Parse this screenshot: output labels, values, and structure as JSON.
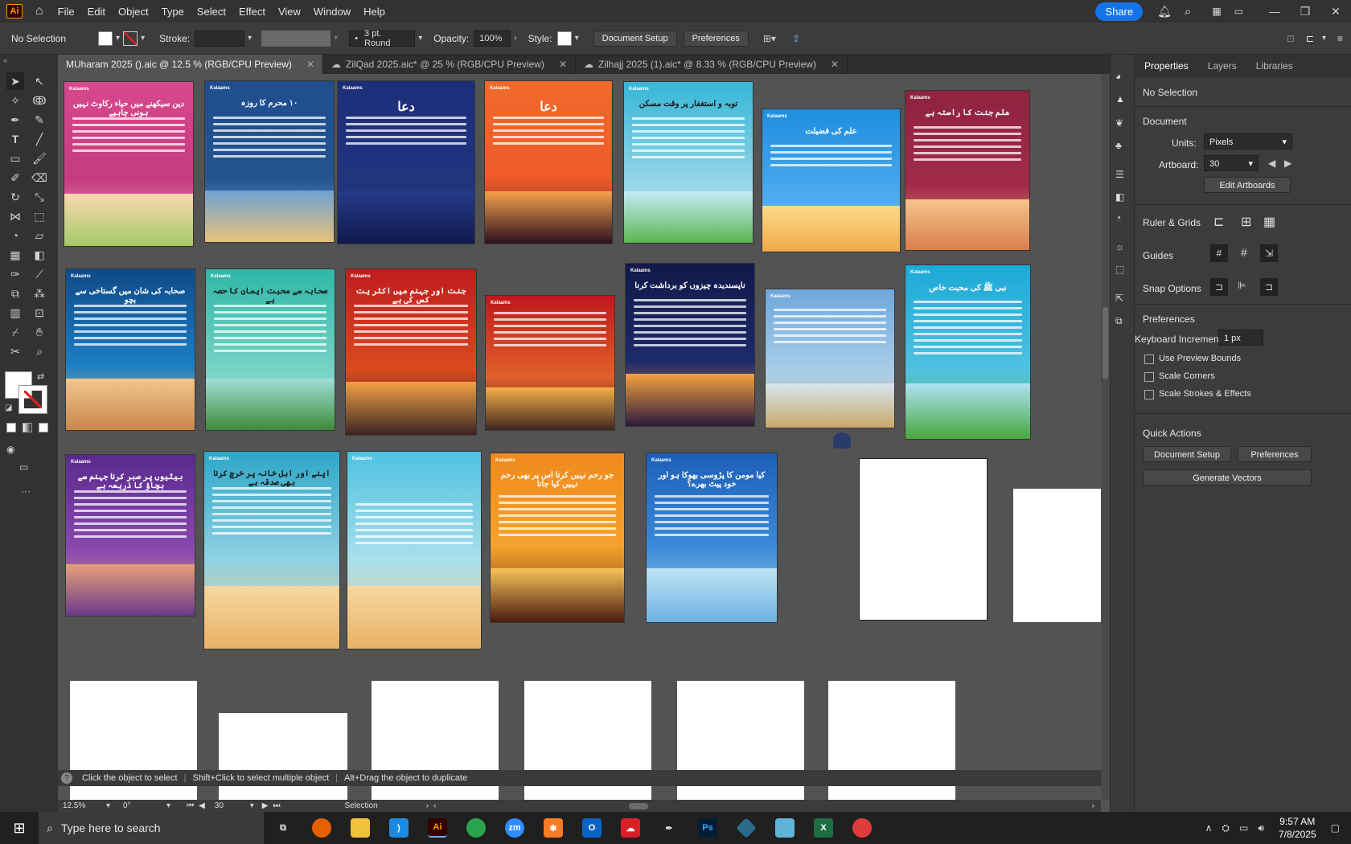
{
  "menubar": {
    "logo": "Ai",
    "items": [
      "File",
      "Edit",
      "Object",
      "Type",
      "Select",
      "Effect",
      "View",
      "Window",
      "Help"
    ],
    "share": "Share"
  },
  "control": {
    "selection": "No Selection",
    "stroke_label": "Stroke:",
    "brush": "3 pt. Round",
    "opacity_label": "Opacity:",
    "opacity": "100%",
    "style_label": "Style:",
    "doc_setup": "Document Setup",
    "preferences": "Preferences"
  },
  "tabs": [
    {
      "label": "MUharam 2025 ().aic @ 12.5 % (RGB/CPU Preview)"
    },
    {
      "label": "ZilQad 2025.aic* @ 25 % (RGB/CPU Preview)"
    },
    {
      "label": "Zilhajj 2025 (1).aic* @ 8.33 % (RGB/CPU Preview)"
    }
  ],
  "props": {
    "tabs": [
      "Properties",
      "Layers",
      "Libraries"
    ],
    "no_selection": "No Selection",
    "document": "Document",
    "units_label": "Units:",
    "units": "Pixels",
    "artboard_label": "Artboard:",
    "artboard": "30",
    "edit_artboards": "Edit Artboards",
    "rulers": "Ruler & Grids",
    "guides": "Guides",
    "snap": "Snap Options",
    "preferences": "Preferences",
    "kb_label": "Keyboard Increment:",
    "kb": "1 px",
    "chk1": "Use Preview Bounds",
    "chk2": "Scale Corners",
    "chk3": "Scale Strokes & Effects",
    "quick": "Quick Actions",
    "qa_doc": "Document Setup",
    "qa_pref": "Preferences",
    "qa_vec": "Generate Vectors"
  },
  "boards": [
    {
      "title": "دین سیکھنے میں حیاء رکاوٹ نہیں ہونی چاہیے",
      "color": "#d9488e"
    },
    {
      "title": "۱۰ محرم کا روزہ",
      "color": "#1f4e8f"
    },
    {
      "title": "دعا",
      "color": "#1c2e7a"
    },
    {
      "title": "دعا",
      "color": "#f06a2a"
    },
    {
      "title": "توبہ و استغفار پر وقت مسکن",
      "color": "#36b6d8"
    },
    {
      "title": "علم کی فضیلت",
      "color": "#1e8ee0"
    },
    {
      "title": "علم جنت کا راستہ ہے",
      "color": "#8e2340"
    },
    {
      "title": "صحابہ کی شان میں گستاخی سے بچو",
      "color": "#0f4a8a"
    },
    {
      "title": "صحابہ سے محبت ایمان کا حصہ ہے",
      "color": "#2fb7a8"
    },
    {
      "title": "جنت اور جہنم میں اکثر یت کس کی ہے",
      "color": "#c01d1d"
    },
    {
      "title": "",
      "color": "#c0161d"
    },
    {
      "title": "ناپسندیدہ چیزوں کو برداشت کرنا",
      "color": "#121a4a"
    },
    {
      "title": "",
      "color": "#6ea8dc"
    },
    {
      "title": "نبی ﷺ کی محبت خاص",
      "color": "#1da9d8"
    },
    {
      "title": "بیٹیوں پر صبر کرنا جہنم سے بچاؤ کا ذریعہ ہے",
      "color": "#5a2a8e"
    },
    {
      "title": "اپنے اور اہل خانہ پر خرچ کرنا بھی صدقہ ہے",
      "color": "#2ea7c8"
    },
    {
      "title": "",
      "color": "#4fc1e0"
    },
    {
      "title": "جو رحم نہیں کرتا اس پر بھی رحم نہیں کیا جاتا",
      "color": "#f08a1c"
    },
    {
      "title": "کیا مومن کا پڑوسی بھوکا ہو اور خود پیٹ بھرے؟",
      "color": "#1d5fb8"
    }
  ],
  "hint": {
    "a": "Click the object to select",
    "b": "Shift+Click to select multiple object",
    "c": "Alt+Drag the object to duplicate"
  },
  "status": {
    "zoom": "12.5%",
    "rotate": "0°",
    "page": "30",
    "tool": "Selection"
  },
  "taskbar": {
    "search": "Type here to search",
    "time": "9:57 AM",
    "date": "7/8/2025"
  }
}
